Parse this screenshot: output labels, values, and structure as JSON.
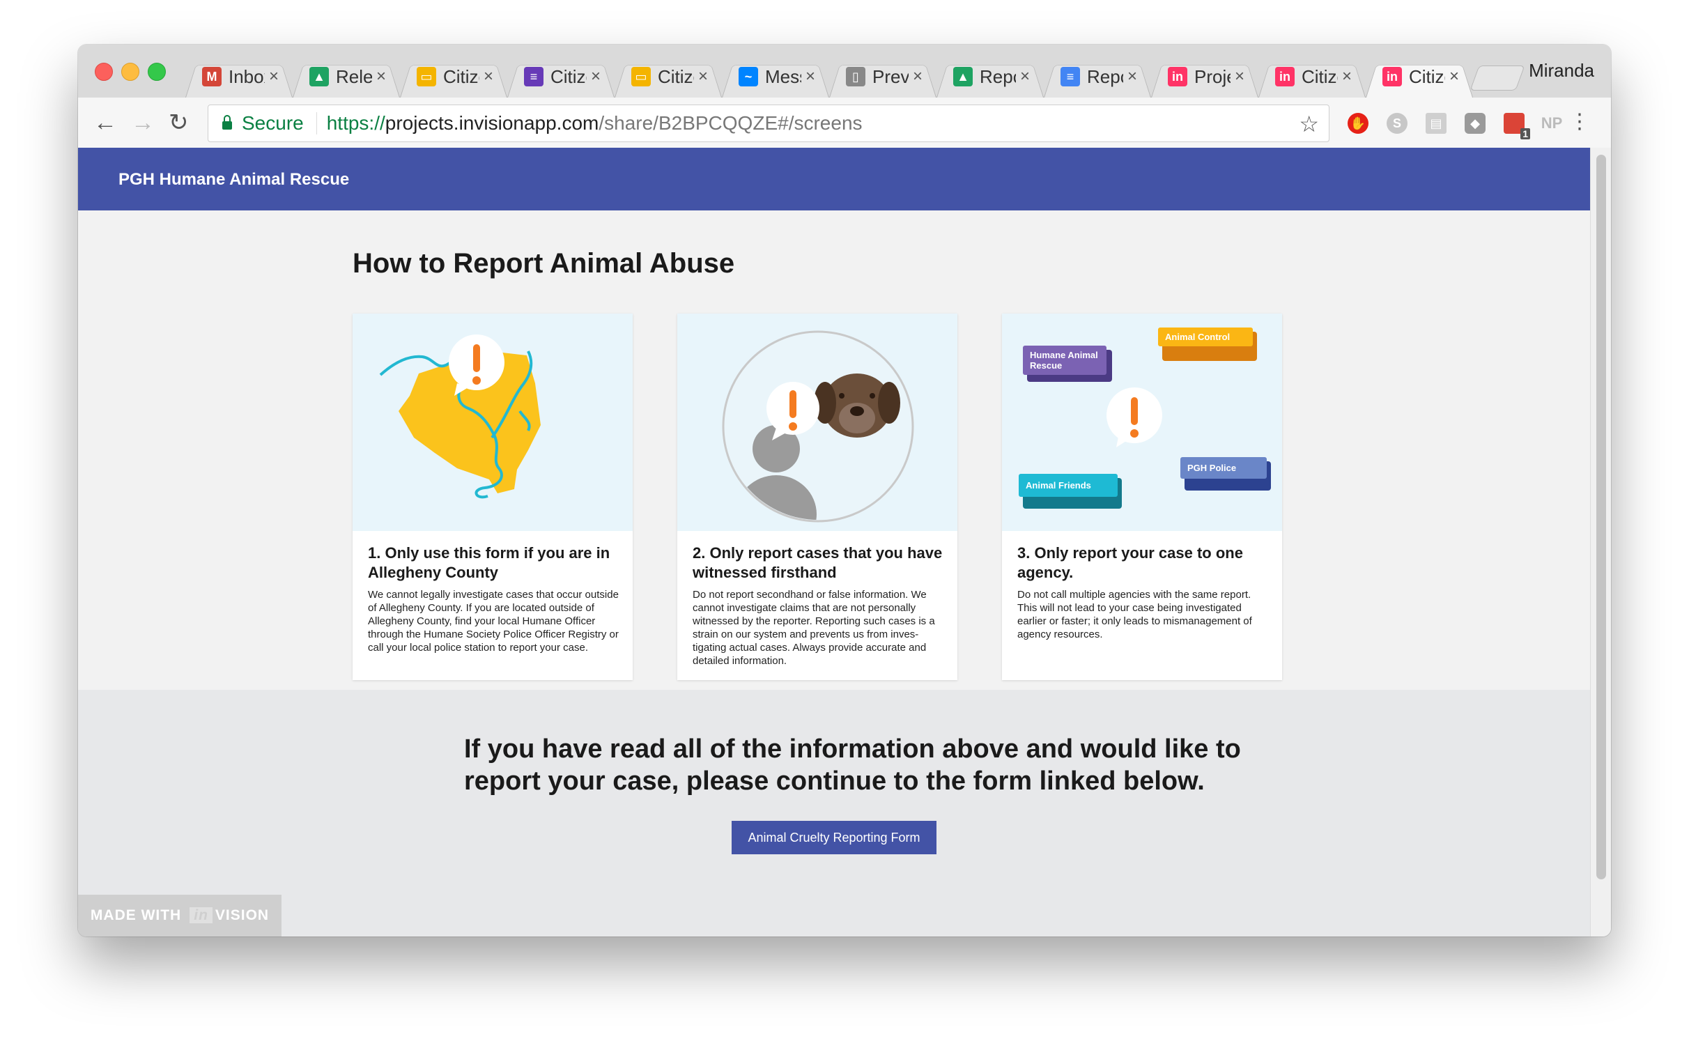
{
  "browser": {
    "tabs": [
      {
        "title": "Inbox",
        "icon": "gmail-icon",
        "color": "#d44638",
        "glyph": "M"
      },
      {
        "title": "Release",
        "icon": "drive-icon",
        "color": "#1ea362",
        "glyph": "▲"
      },
      {
        "title": "Citizen",
        "icon": "slides-icon",
        "color": "#f4b400",
        "glyph": "▭"
      },
      {
        "title": "Citizen",
        "icon": "forms-icon",
        "color": "#673ab7",
        "glyph": "≡"
      },
      {
        "title": "Citizen",
        "icon": "slides-icon",
        "color": "#f4b400",
        "glyph": "▭"
      },
      {
        "title": "Messenger",
        "icon": "messenger-icon",
        "color": "#0084ff",
        "glyph": "~"
      },
      {
        "title": "Preview",
        "icon": "document-icon",
        "color": "#888888",
        "glyph": "▯"
      },
      {
        "title": "Report",
        "icon": "drive-icon",
        "color": "#1ea362",
        "glyph": "▲"
      },
      {
        "title": "Report",
        "icon": "docs-icon",
        "color": "#4285f4",
        "glyph": "≡"
      },
      {
        "title": "Project",
        "icon": "invision-icon",
        "color": "#ff3366",
        "glyph": "in"
      },
      {
        "title": "Citizen",
        "icon": "invision-icon",
        "color": "#ff3366",
        "glyph": "in"
      },
      {
        "title": "Citizen",
        "icon": "invision-icon",
        "color": "#ff3366",
        "glyph": "in"
      }
    ],
    "profile_name": "Miranda",
    "secure_label": "Secure",
    "url_scheme": "https://",
    "url_host": "projects.invisionapp.com",
    "url_path": "/share/B2BPCQQZE#/screens",
    "extension_badge": "1",
    "extension_np": "NP"
  },
  "page": {
    "brand": "PGH Humane Animal Rescue",
    "title": "How to Report Animal Abuse",
    "cards": [
      {
        "heading": "1. Only use this form if you are in Allegheny County",
        "body": "We cannot legally investigate cases that occur outside of Allegheny County. If you are located outside of Allegheny County, find your local Humane Officer through the Humane Society Police Officer Registry or call your local police station to report your case."
      },
      {
        "heading": "2. Only report cases that you have witnessed firsthand",
        "body": "Do not report secondhand or false information. We cannot investigate claims that are not personally witnessed by the reporter. Reporting such cases is a strain on our system and prevents us from inves-tigating actual cases. Always provide accurate and detailed information."
      },
      {
        "heading": "3. Only report your case to one agency.",
        "body": "Do not call multiple agencies with the same report. This will not lead to your case being investigated earlier or faster; it only leads to mismanagement of agency resources."
      }
    ],
    "agencies": {
      "humane": "Humane Animal Rescue",
      "control": "Animal Control",
      "friends": "Animal Friends",
      "police": "PGH Police"
    },
    "cta_text": "If you have read all of the information above and would like to report your case, please continue to the form linked below.",
    "cta_button": "Animal Cruelty Reporting Form",
    "badge_prefix": "MADE WITH",
    "badge_logo_in": "in",
    "badge_logo_rest": "VISION"
  },
  "colors": {
    "appbar": "#4353a6",
    "map_yellow": "#fbc31c",
    "river_teal": "#22b8d1",
    "alert_orange": "#f47b20"
  }
}
